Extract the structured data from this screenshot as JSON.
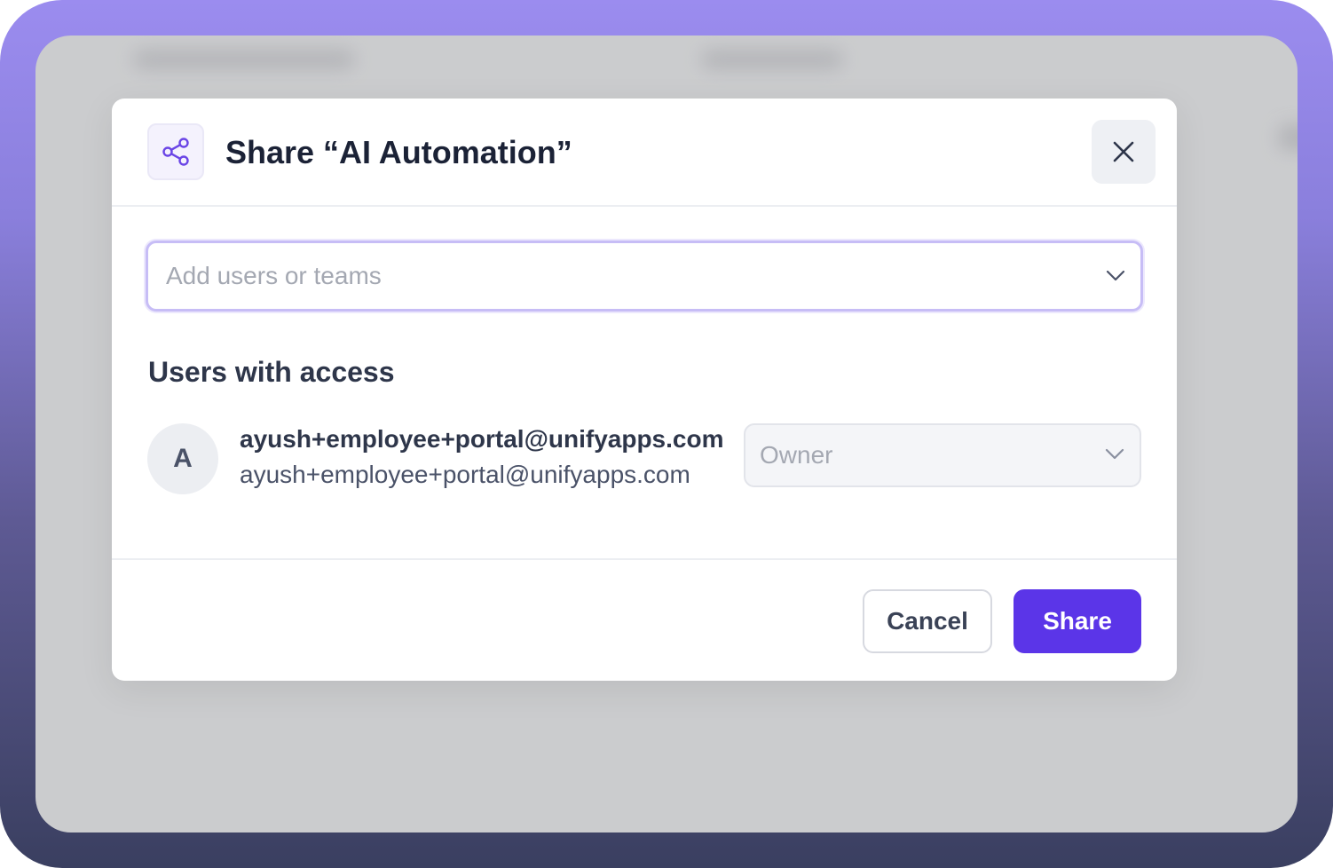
{
  "colors": {
    "accent": "#5b35e8",
    "focus_ring": "#c7bdf6",
    "overlay": "#cbccce",
    "frame_top": "#9b8cef",
    "frame_bottom": "#3a3f60"
  },
  "modal": {
    "header_icon": "share-icon",
    "title": "Share “AI Automation”",
    "close_icon": "close-icon"
  },
  "add_field": {
    "placeholder": "Add users or teams",
    "icon": "chevron-down-icon"
  },
  "access": {
    "section_title": "Users with access",
    "users": [
      {
        "avatar_letter": "A",
        "name": "ayush+employee+portal@unifyapps.com",
        "email": "ayush+employee+portal@unifyapps.com",
        "role": "Owner",
        "role_icon": "chevron-down-icon"
      }
    ]
  },
  "footer": {
    "cancel_label": "Cancel",
    "share_label": "Share"
  }
}
